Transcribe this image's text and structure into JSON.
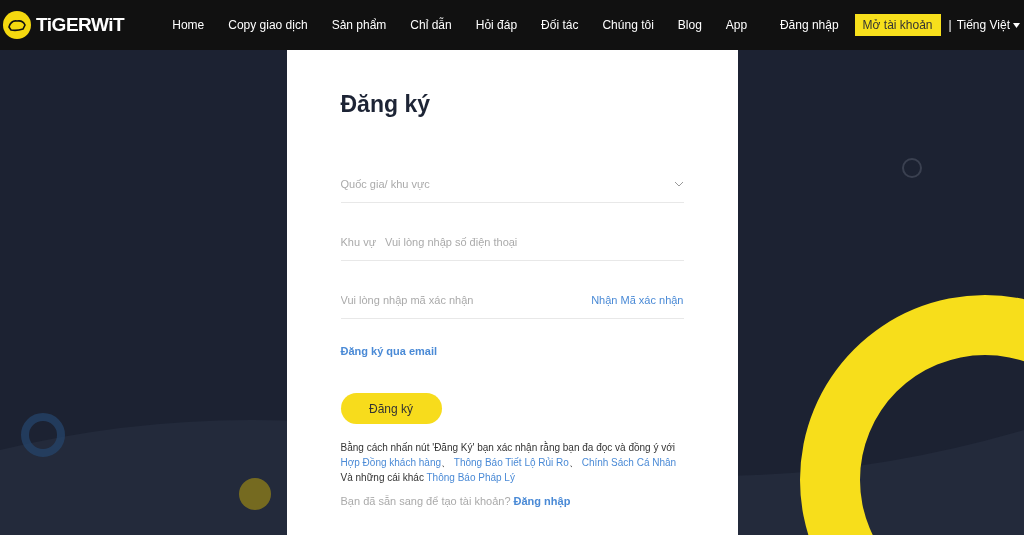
{
  "header": {
    "logo_text": "TiGERWiT",
    "nav": [
      "Home",
      "Copy giao dịch",
      "Sản phẩm",
      "Chỉ dẫn",
      "Hỏi đáp",
      "Đối tác",
      "Chúng tôi",
      "Blog",
      "App"
    ],
    "login": "Đăng nhập",
    "open_account": "Mở tài khoản",
    "separator": "|",
    "language": "Tiếng Việt"
  },
  "form": {
    "title": "Đăng ký",
    "country": {
      "placeholder": "Quốc gia/ khu vực"
    },
    "phone": {
      "prefix": "Khu vự",
      "placeholder": "Vui lòng nhập số điện thoại"
    },
    "code": {
      "placeholder": "Vui lòng nhập mã xác nhận",
      "action": "Nhận Mã xác nhận"
    },
    "email_link": "Đăng ký qua email",
    "submit": "Đăng ký",
    "legal": [
      {
        "kind": "text",
        "text": "Bằng cách nhấn nút 'Đăng Ký' bạn xác nhận rằng bạn đa đọc và đồng ý với "
      },
      {
        "kind": "link",
        "text": "Hợp Đồng khách hàng"
      },
      {
        "kind": "text",
        "text": "、 "
      },
      {
        "kind": "link",
        "text": "Thông Báo Tiết Lộ Rủi Ro"
      },
      {
        "kind": "text",
        "text": "、 "
      },
      {
        "kind": "link",
        "text": "Chính Sách Cá Nhân"
      },
      {
        "kind": "text",
        "text": " Và những cái khác "
      },
      {
        "kind": "link",
        "text": "Thông Báo Pháp Lý"
      }
    ],
    "have_account": "Bạn đã sẵn sang để tạo tài khoản?",
    "login_link": "Đăng nhập"
  }
}
